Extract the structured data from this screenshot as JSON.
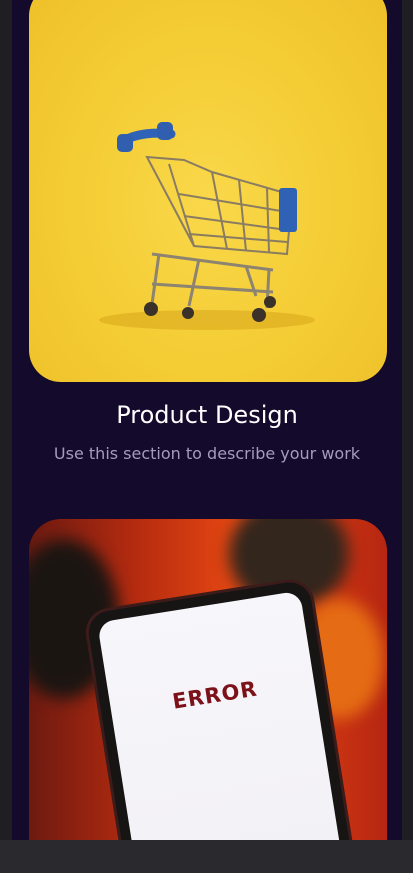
{
  "portfolio": {
    "items": [
      {
        "title": "Product Design",
        "description": "Use this section to describe your work",
        "image": "shopping-cart-photo"
      },
      {
        "image": "error-phone-photo",
        "screen_text": "ERROR"
      }
    ]
  },
  "colors": {
    "background": "#130a2c",
    "title": "#ffffff",
    "description": "#a79bbc",
    "frame": "#232226"
  }
}
